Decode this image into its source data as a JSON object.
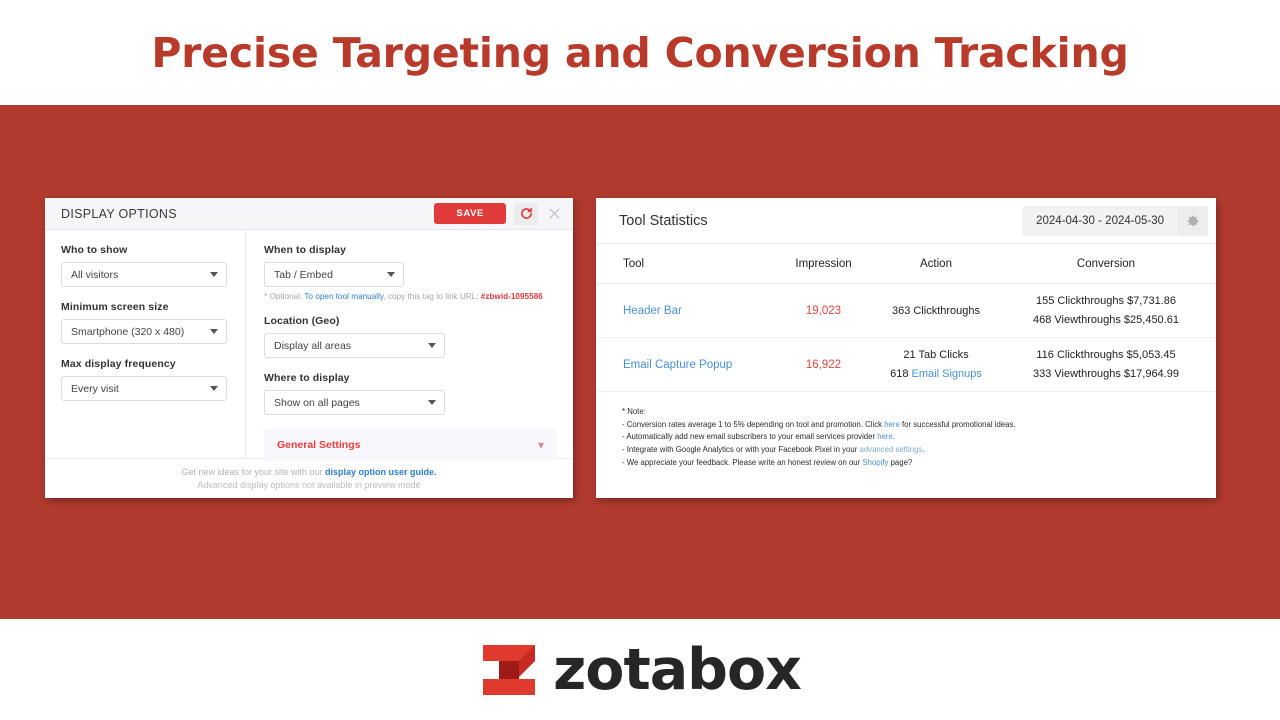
{
  "title": "Precise Targeting and Conversion Tracking",
  "colors": {
    "brand_red": "#B13A2E",
    "title_red": "#B83A2B",
    "accent_red": "#e03a3a",
    "link_blue": "#4a90d9"
  },
  "display_options": {
    "header_title": "DISPLAY OPTIONS",
    "save_label": "SAVE",
    "refresh_icon": "refresh-icon",
    "close_icon": "close-icon",
    "left_column": {
      "fields": [
        {
          "label": "Who to show",
          "value": "All visitors"
        },
        {
          "label": "Minimum screen size",
          "value": "Smartphone (320 x 480)"
        },
        {
          "label": "Max display frequency",
          "value": "Every visit"
        }
      ]
    },
    "right_column": {
      "when_label": "When to display",
      "when_value": "Tab / Embed",
      "optional_prefix": "* Optional: ",
      "optional_link": "To open tool manually",
      "optional_middle": ", copy this tag to link URL: ",
      "optional_tag": "#zbwid-1095586",
      "location_label": "Location (Geo)",
      "location_value": "Display all areas",
      "where_label": "Where to display",
      "where_value": "Show on all pages",
      "general_settings_label": "General Settings",
      "general_settings_chevron": "chevron-down-icon"
    },
    "footer": {
      "line1_prefix": "Get new ideas for your site with our ",
      "line1_link": "display option user guide.",
      "line2": "Advanced display options not available in preview mode"
    }
  },
  "tool_statistics": {
    "title": "Tool Statistics",
    "date_range": "2024-04-30 - 2024-05-30",
    "gear_icon": "gear-icon",
    "columns": [
      "Tool",
      "Impression",
      "Action",
      "Conversion"
    ],
    "rows": [
      {
        "tool": "Header Bar",
        "impression": "19,023",
        "action_lines": [
          {
            "text": "363 Clickthroughs",
            "link": ""
          }
        ],
        "conversion_lines": [
          "155 Clickthroughs $7,731.86",
          "468 Viewthroughs $25,450.61"
        ]
      },
      {
        "tool": "Email Capture Popup",
        "impression": "16,922",
        "action_lines": [
          {
            "text": "21 Tab Clicks",
            "link": ""
          },
          {
            "text": "618 ",
            "link": "Email Signups"
          }
        ],
        "conversion_lines": [
          "116 Clickthroughs $5,053.45",
          "333 Viewthroughs $17,964.99"
        ]
      }
    ],
    "note": {
      "heading": "* Note:",
      "line1_a": "- Conversion rates average 1 to 5% depending on tool and promotion. Click ",
      "line1_link": "here",
      "line1_b": " for successful promotional ideas.",
      "line2_a": "- Automatically add new email subscribers to your email services provider ",
      "line2_link": "here",
      "line2_b": ".",
      "line3_a": "- Integrate with Google Analytics or with your Facebook Pixel in your ",
      "line3_link": "advanced settings",
      "line3_b": ".",
      "line4_a": "- We appreciate your feedback. Please write an honest review on our ",
      "line4_link": "Shopify",
      "line4_b": " page?"
    }
  },
  "logo": {
    "wordmark": "zotabox",
    "mark_icon": "zotabox-z-mark"
  }
}
